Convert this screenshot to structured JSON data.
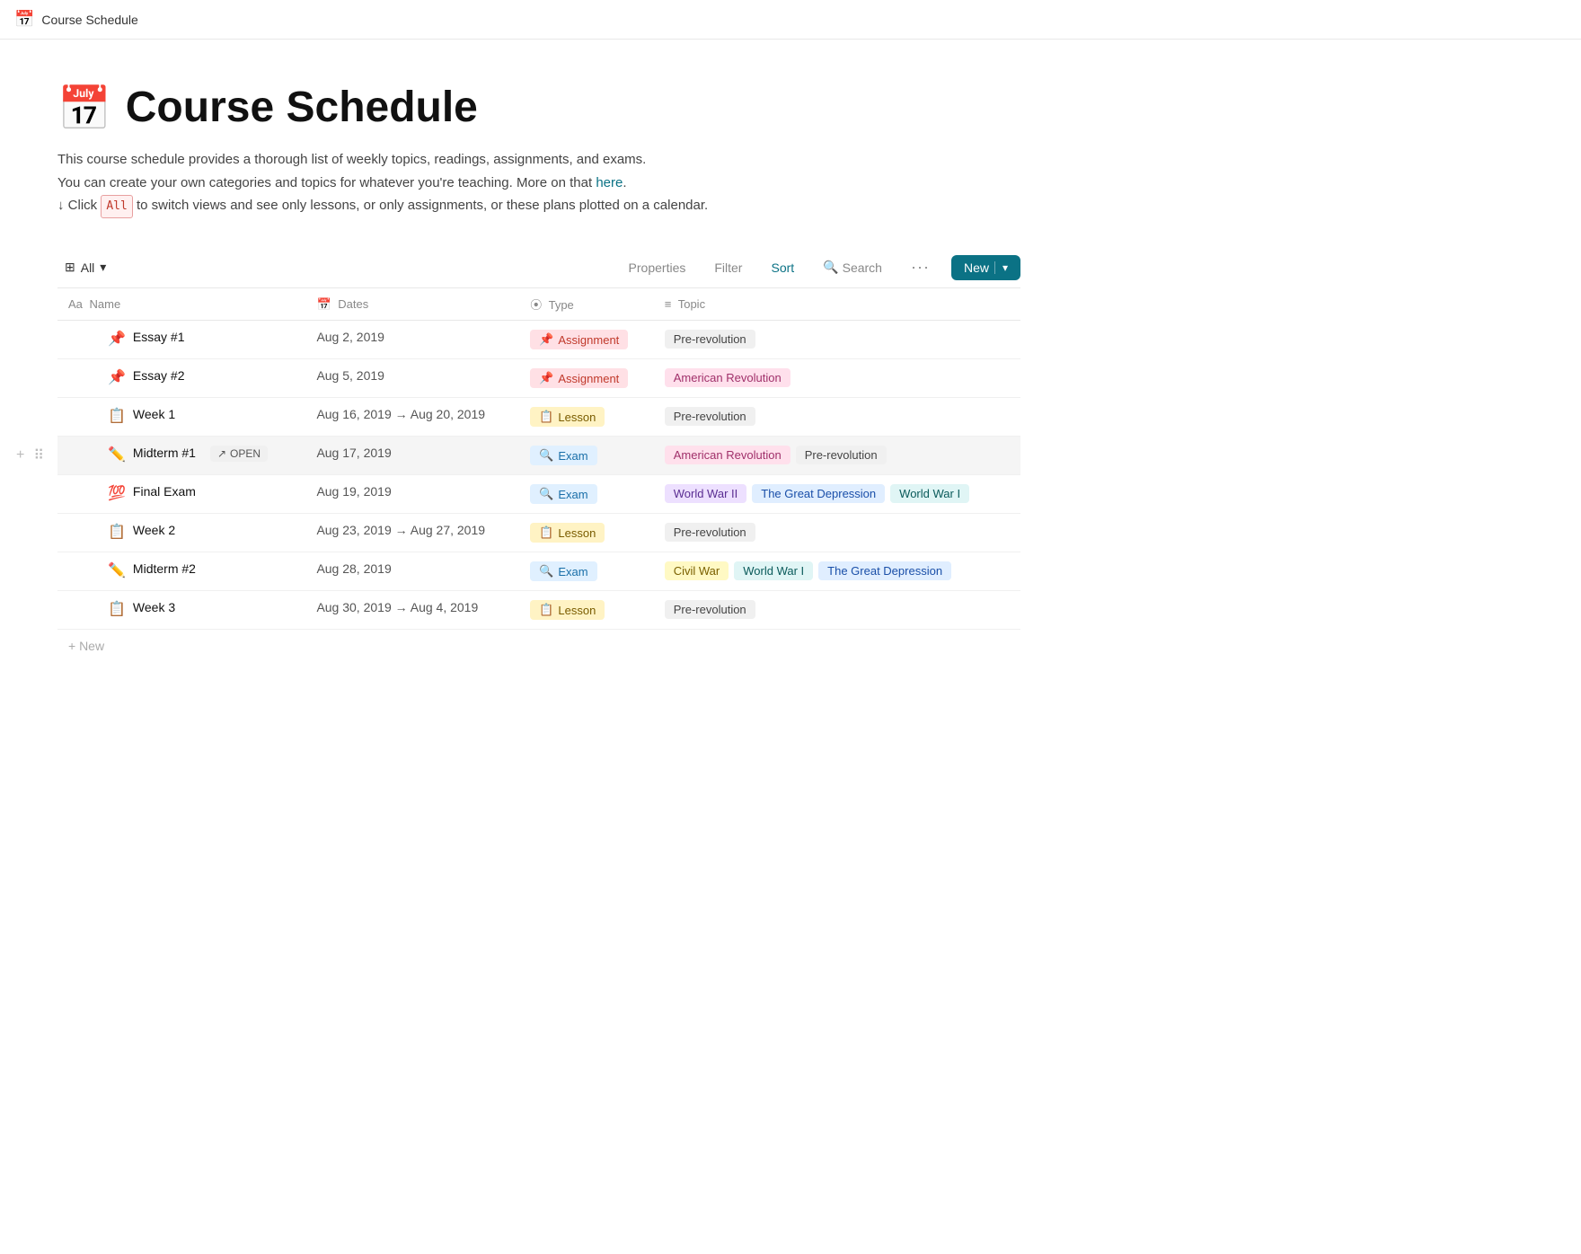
{
  "topbar": {
    "icon": "📅",
    "title": "Course Schedule"
  },
  "page": {
    "icon": "📅",
    "title": "Course Schedule",
    "description_line1": "This course schedule provides a thorough list of weekly topics, readings, assignments, and exams.",
    "description_line2": "You can create your own categories and topics for whatever you're teaching. More on that",
    "description_link": "here",
    "description_line3": "↓ Click",
    "all_badge": "All",
    "description_line3_end": "to switch views and see only lessons, or only assignments, or these plans plotted on a calendar."
  },
  "toolbar": {
    "view_label": "All",
    "view_icon": "▾",
    "properties_label": "Properties",
    "filter_label": "Filter",
    "sort_label": "Sort",
    "search_label": "Search",
    "dots_label": "···",
    "new_label": "New",
    "new_arrow": "▾"
  },
  "columns": [
    {
      "id": "name",
      "icon": "Aa",
      "label": "Name"
    },
    {
      "id": "dates",
      "icon": "📅",
      "label": "Dates"
    },
    {
      "id": "type",
      "icon": "⦿",
      "label": "Type"
    },
    {
      "id": "topic",
      "icon": "≡",
      "label": "Topic"
    }
  ],
  "rows": [
    {
      "icon": "📌",
      "name": "Essay #1",
      "date": "Aug 2, 2019",
      "type": "Assignment",
      "type_class": "assignment",
      "topics": [
        {
          "label": "Pre-revolution",
          "class": "gray"
        }
      ]
    },
    {
      "icon": "📌",
      "name": "Essay #2",
      "date": "Aug 5, 2019",
      "type": "Assignment",
      "type_class": "assignment",
      "topics": [
        {
          "label": "American Revolution",
          "class": "pink"
        }
      ]
    },
    {
      "icon": "📋",
      "name": "Week 1",
      "date": "Aug 16, 2019 → Aug 20, 2019",
      "type": "Lesson",
      "type_class": "lesson",
      "topics": [
        {
          "label": "Pre-revolution",
          "class": "gray"
        }
      ]
    },
    {
      "icon": "✏️",
      "name": "Midterm #1",
      "date": "Aug 17, 2019",
      "type": "Exam",
      "type_class": "exam",
      "active": true,
      "show_open": true,
      "topics": [
        {
          "label": "American Revolution",
          "class": "pink"
        },
        {
          "label": "Pre-revolution",
          "class": "gray"
        }
      ]
    },
    {
      "icon": "💯",
      "name": "Final Exam",
      "date": "Aug 19, 2019",
      "type": "Exam",
      "type_class": "exam",
      "topics": [
        {
          "label": "World War II",
          "class": "purple"
        },
        {
          "label": "The Great Depression",
          "class": "blue"
        },
        {
          "label": "World War I",
          "class": "teal"
        }
      ]
    },
    {
      "icon": "📋",
      "name": "Week 2",
      "date": "Aug 23, 2019 → Aug 27, 2019",
      "type": "Lesson",
      "type_class": "lesson",
      "topics": [
        {
          "label": "Pre-revolution",
          "class": "gray"
        }
      ]
    },
    {
      "icon": "✏️",
      "name": "Midterm #2",
      "date": "Aug 28, 2019",
      "type": "Exam",
      "type_class": "exam",
      "topics": [
        {
          "label": "Civil War",
          "class": "yellow"
        },
        {
          "label": "World War I",
          "class": "teal"
        },
        {
          "label": "The Great Depression",
          "class": "blue"
        }
      ]
    },
    {
      "icon": "📋",
      "name": "Week 3",
      "date": "Aug 30, 2019 → Aug 4, 2019",
      "type": "Lesson",
      "type_class": "lesson",
      "topics": [
        {
          "label": "Pre-revolution",
          "class": "gray"
        }
      ]
    }
  ],
  "new_row_label": "+ New"
}
